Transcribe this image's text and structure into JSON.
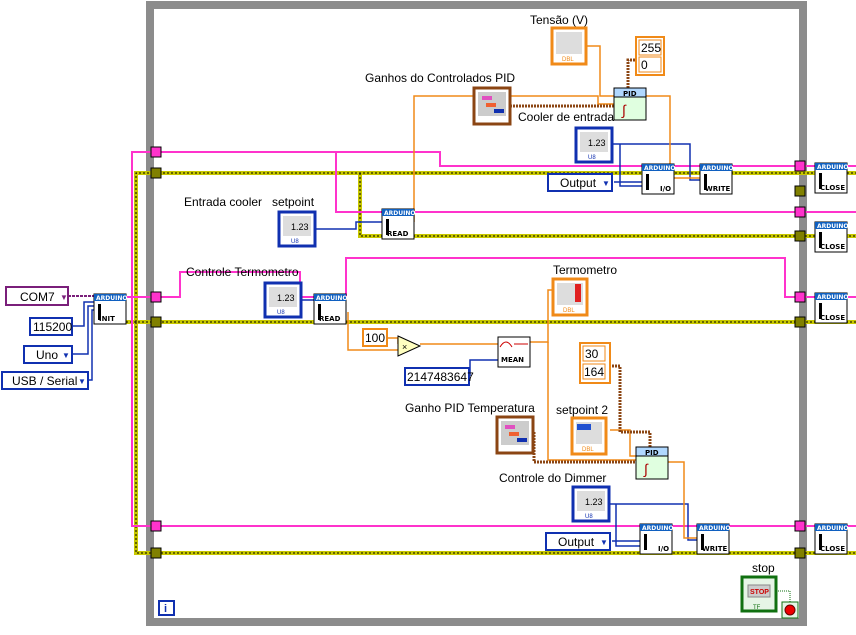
{
  "colors": {
    "resource_wire": "#ff33cc",
    "error_wire": "#c8c800",
    "numeric_dbl": "#f08a18",
    "numeric_int": "#1030b0",
    "cluster": "#8b4513",
    "bool": "#107010",
    "loop": "#8c8c8c",
    "visa": "#7a1f7a"
  },
  "inputs": {
    "com_port": "COM7",
    "baud_rate": "115200",
    "board": "Uno",
    "connection": "USB / Serial"
  },
  "labels": {
    "tensao": "Tensão (V)",
    "ganhos_pid": "Ganhos do Controlados PID",
    "cooler_entrada": "Cooler de entrada",
    "entrada_cooler": "Entrada cooler",
    "setpoint": "setpoint",
    "controle_termometro": "Controle Termometro",
    "termometro": "Termometro",
    "ganho_pid_temp": "Ganho PID Temperatura",
    "setpoint2": "setpoint 2",
    "controle_dimmer": "Controle do Dimmer",
    "stop": "stop"
  },
  "constants": {
    "limits1": [
      "255",
      "0"
    ],
    "limits2": [
      "30",
      "164"
    ],
    "multiplier": "100",
    "mean_samples": "2147483647",
    "output_mode_1": "Output",
    "output_mode_2": "Output"
  },
  "nodes": {
    "arduino": "ARDUINO",
    "init": "INIT",
    "read": "READ",
    "write": "WRITE",
    "io": "I/O",
    "close": "CLOSE",
    "pid": "PID",
    "mean": "MEAN",
    "ub": "U8",
    "dbl": "DBL",
    "tf": "TF",
    "stop_btn": "STOP",
    "mult": "×",
    "numeric": "1.23",
    "info": "i"
  },
  "icons": [
    "arduino-init-icon",
    "arduino-read-icon",
    "arduino-write-icon",
    "arduino-io-icon",
    "arduino-close-icon",
    "pid-icon",
    "knob-icon",
    "thermometer-icon",
    "slide-icon",
    "stop-button-icon",
    "loop-condition-icon",
    "info-icon"
  ]
}
